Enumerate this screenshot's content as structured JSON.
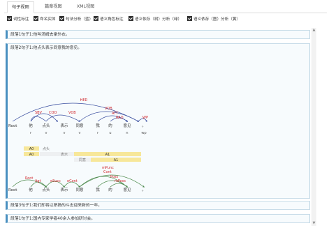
{
  "tabs": [
    {
      "label": "句子视图",
      "active": true
    },
    {
      "label": "篇章视图",
      "active": false
    },
    {
      "label": "XML视图",
      "active": false
    }
  ],
  "options": [
    {
      "label": "词性标注",
      "checked": true
    },
    {
      "label": "命名实体",
      "checked": true
    },
    {
      "label": "句法分析（蓝）",
      "checked": true
    },
    {
      "label": "语义角色标注",
      "checked": true
    },
    {
      "label": "语义依存（树）分析（绿）",
      "checked": true
    },
    {
      "label": "语义依存（图）分析（黄）",
      "checked": true
    }
  ],
  "paragraphs": [
    {
      "text": "段落1句子1:他叫汤姆去拿外衣。"
    },
    {
      "text": "段落2句子1:他点头表示同意我的意见。"
    },
    {
      "text": "段落3句子1:我们即将以昂扬的斗志迎来新的一年。"
    },
    {
      "text": "段落1句子1:国内专家学者40余人参加研讨会。"
    }
  ],
  "parse": {
    "root_label": "Root",
    "words": [
      "他",
      "点头",
      "表示",
      "同意",
      "我",
      "的",
      "意见",
      "。"
    ],
    "pos": [
      "r",
      "v",
      "v",
      "v",
      "r",
      "u",
      "n",
      "wp"
    ],
    "arc_labels_top": [
      "HED",
      "SBV",
      "COO",
      "VOB",
      "VOB",
      "ATT",
      "RAD",
      "WP"
    ],
    "arc_labels_bottom": [
      "Root",
      "Agt",
      "eSucc",
      "eCont",
      "Cont",
      "Poss",
      "mPoss",
      "mPunc"
    ]
  },
  "srl": {
    "row1": [
      "A0",
      "点头"
    ],
    "row2": [
      "A0",
      "表示",
      "A1"
    ],
    "row3": [
      "同意",
      "A1"
    ]
  },
  "colors": {
    "accent": "#4a90c0",
    "syntax_arc": "#3a4fa0",
    "semantic_arc": "#4d8a4d",
    "arc_label": "#d0282e",
    "srl_bar": "#f7e79a"
  }
}
